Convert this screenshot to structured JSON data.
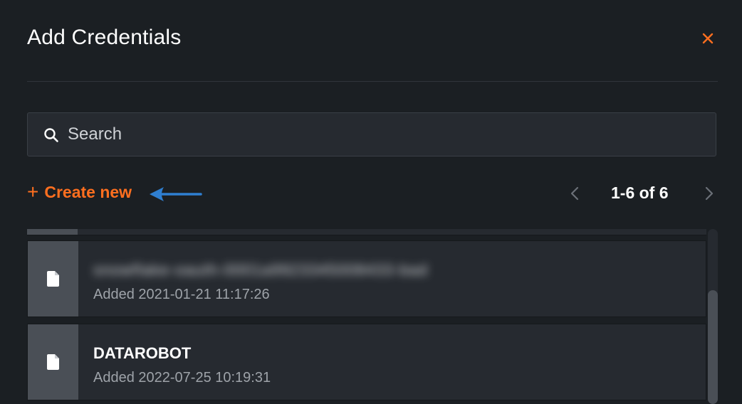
{
  "dialog": {
    "title": "Add Credentials",
    "close_icon": "close-icon"
  },
  "search": {
    "placeholder": "Search",
    "value": ""
  },
  "actions": {
    "create_new_plus": "+",
    "create_new_label": "Create new"
  },
  "pagination": {
    "label": "1-6 of 6",
    "prev_icon": "chevron-left-icon",
    "next_icon": "chevron-right-icon"
  },
  "credentials": [
    {
      "name": "snowflake-oauth-0001a9923345008433-bad",
      "added": "Added 2021-01-21 11:17:26",
      "name_obscured": true,
      "icon": "document-icon"
    },
    {
      "name": "DATAROBOT",
      "added": "Added 2022-07-25 10:19:31",
      "name_obscured": false,
      "icon": "document-icon"
    }
  ],
  "colors": {
    "background": "#1b1f23",
    "accent": "#ff6f1f",
    "annotation_arrow": "#2f7fd1",
    "row_background": "#262a30",
    "icon_column": "#4a4f56",
    "muted_text": "#9ea3a9"
  }
}
